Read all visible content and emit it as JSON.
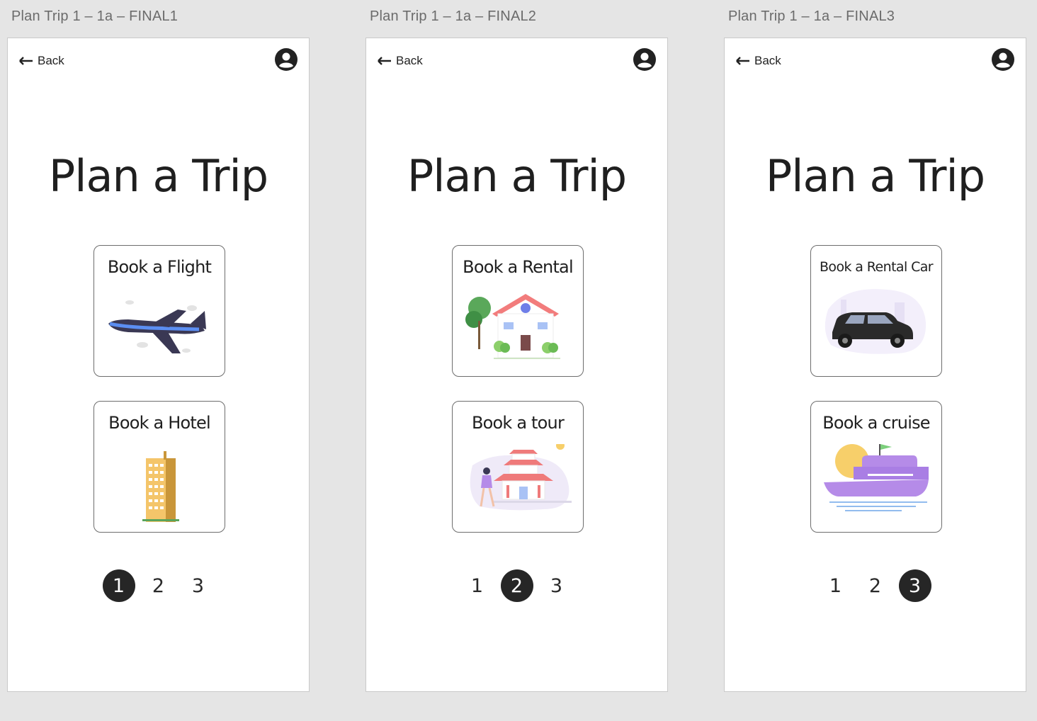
{
  "artboards": [
    {
      "title": "Plan Trip 1 – 1a – FINAL1",
      "back_label": "Back",
      "heading": "Plan a Trip",
      "cards": [
        {
          "label": "Book a Flight",
          "icon": "airplane-illustration"
        },
        {
          "label": "Book a Hotel",
          "icon": "hotel-building-illustration"
        }
      ],
      "pages": [
        "1",
        "2",
        "3"
      ],
      "active_page": "1"
    },
    {
      "title": "Plan Trip 1 – 1a – FINAL2",
      "back_label": "Back",
      "heading": "Plan a Trip",
      "cards": [
        {
          "label": "Book a Rental",
          "icon": "house-illustration"
        },
        {
          "label": "Book a tour",
          "icon": "pagoda-tour-illustration"
        }
      ],
      "pages": [
        "1",
        "2",
        "3"
      ],
      "active_page": "2"
    },
    {
      "title": "Plan Trip 1 – 1a – FINAL3",
      "back_label": "Back",
      "heading": "Plan a Trip",
      "cards": [
        {
          "label": "Book a Rental Car",
          "icon": "car-illustration"
        },
        {
          "label": "Book a cruise",
          "icon": "cruise-ship-illustration"
        }
      ],
      "pages": [
        "1",
        "2",
        "3"
      ],
      "active_page": "3"
    }
  ],
  "colors": {
    "background": "#e5e5e5",
    "frame": "#ffffff",
    "text": "#1f1f1f",
    "active_page": "#262626",
    "card_border": "#6d6d6d"
  }
}
